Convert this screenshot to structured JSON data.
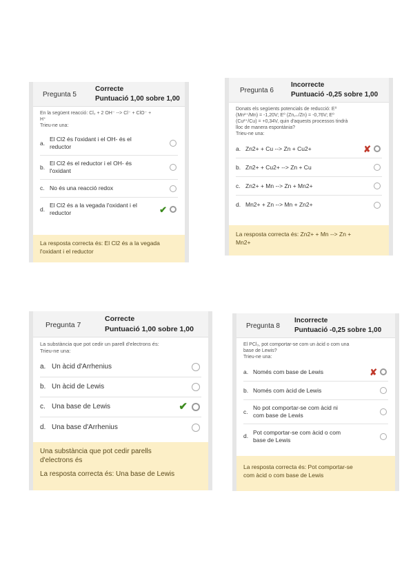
{
  "q5": {
    "number": "Pregunta 5",
    "state": "Correcte",
    "grade": "Puntuació 1,00 sobre 1,00",
    "prompt_line1": "En la següent reacció: Cl₂ + 2 OH⁻ --> Cl⁻ + ClO⁻ +",
    "prompt_line2": "H⁺",
    "prompt_line3": "Trieu-ne una:",
    "options": [
      {
        "letter": "a.",
        "line1": "El Cl2 és l'oxidant i el OH- és el",
        "line2": "reductor"
      },
      {
        "letter": "b.",
        "line1": "El Cl2 és el reductor i el OH- és",
        "line2": "l'oxidant"
      },
      {
        "letter": "c.",
        "line1": "No és una reacció redox",
        "line2": ""
      },
      {
        "letter": "d.",
        "line1": "El Cl2 és a la vegada l'oxidant i el",
        "line2": "reductor"
      }
    ],
    "feedback_line1": "La resposta correcta és: El Cl2 és a la vegada",
    "feedback_line2": "l'oxidant i el reductor"
  },
  "q6": {
    "number": "Pregunta 6",
    "state": "Incorrecte",
    "grade": "Puntuació -0,25 sobre 1,00",
    "prompt_line1": "Donats els següents potencials de reducció: E⁰",
    "prompt_line2": "(Mn²⁺/Mn) = -1,20V; E⁰ (Zn₂₊/Zn) = -0,76V; E⁰",
    "prompt_line3": "(Cu²⁺/Cu) = +0,34V, quin d'aquests processos tindrà",
    "prompt_line4": "lloc de manera espontània?",
    "prompt_line5": "Trieu-ne una:",
    "options": [
      {
        "letter": "a.",
        "text": "Zn2+ + Cu --> Zn + Cu2+"
      },
      {
        "letter": "b.",
        "text": "Zn2+ + Cu2+ --> Zn + Cu"
      },
      {
        "letter": "c.",
        "text": "Zn2+ + Mn --> Zn + Mn2+"
      },
      {
        "letter": "d.",
        "text": "Mn2+ + Zn --> Mn + Zn2+"
      }
    ],
    "feedback_line1": "La resposta correcta és: Zn2+ + Mn --> Zn +",
    "feedback_line2": "Mn2+"
  },
  "q7": {
    "number": "Pregunta 7",
    "state": "Correcte",
    "grade": "Puntuació 1,00 sobre 1,00",
    "prompt_line1": "La substància que pot cedir un parell d'electrons és:",
    "prompt_line2": "Trieu-ne una:",
    "options": [
      {
        "letter": "a.",
        "text": "Un àcid d'Arrhenius"
      },
      {
        "letter": "b.",
        "text": "Un àcid de Lewis"
      },
      {
        "letter": "c.",
        "text": "Una base de Lewis"
      },
      {
        "letter": "d.",
        "text": "Una base d'Arrhenius"
      }
    ],
    "feedback_line1": "Una substància que pot cedir parells",
    "feedback_line2": "d'electrons és",
    "feedback_line3": "La resposta correcta és: Una base de Lewis"
  },
  "q8": {
    "number": "Pregunta 8",
    "state": "Incorrecte",
    "grade": "Puntuació -0,25 sobre 1,00",
    "prompt_line1": "El PCl₃, pot comportar-se com un àcid o com una",
    "prompt_line2": "base de Lewis?",
    "prompt_line3": "Trieu-ne una:",
    "options": [
      {
        "letter": "a.",
        "line1": "Només com base de Lewis",
        "line2": ""
      },
      {
        "letter": "b.",
        "line1": "Només com àcid de Lewis",
        "line2": ""
      },
      {
        "letter": "c.",
        "line1": "No pot comportar-se com àcid ni",
        "line2": "com base de Lewis"
      },
      {
        "letter": "d.",
        "line1": "Pot comportar-se com àcid o com",
        "line2": "base de Lewis"
      }
    ],
    "feedback_line1": "La resposta correcta és: Pot comportar-se",
    "feedback_line2": "com àcid o com base de Lewis"
  },
  "marks": {
    "check": "✔",
    "cross": "✘"
  },
  "colors": {
    "feedback_bg": "#fcefc7",
    "correct": "#3c8a1e",
    "incorrect": "#c0392b"
  }
}
